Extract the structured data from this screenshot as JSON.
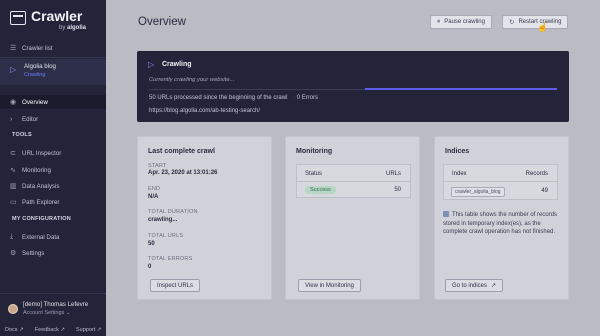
{
  "app": {
    "name": "Crawler",
    "by": "by",
    "brand": "algolia"
  },
  "sidebar": {
    "crawler_list": "Crawler list",
    "project": {
      "name": "Algolia blog",
      "status": "Crawling"
    },
    "items_top": [
      {
        "label": "Overview",
        "icon": "eye-icon"
      },
      {
        "label": "Editor",
        "icon": "code-icon"
      }
    ],
    "tools_heading": "TOOLS",
    "tools": [
      {
        "label": "URL Inspector"
      },
      {
        "label": "Monitoring"
      },
      {
        "label": "Data Analysis"
      },
      {
        "label": "Path Explorer"
      }
    ],
    "config_heading": "MY CONFIGURATION",
    "config": [
      {
        "label": "External Data"
      },
      {
        "label": "Settings"
      }
    ],
    "user": {
      "name": "[demo] Thomas Lefevre",
      "settings": "Account Settings"
    },
    "footer": {
      "docs": "Docs",
      "feedback": "Feedback",
      "support": "Support"
    }
  },
  "main": {
    "title": "Overview",
    "pause_button": "Pause crawling",
    "restart_button": "Restart crawling",
    "crawl": {
      "title": "Crawling",
      "status": "Currently crawling your website...",
      "urls_count": "50",
      "urls_text": "URLs processed since the beginning of the crawl",
      "errors_count": "0",
      "errors_text": "Errors",
      "url": "https://blog.algolia.com/ab-testing-search/",
      "progress": 0.47
    },
    "last_crawl": {
      "title": "Last complete crawl",
      "start_label": "START",
      "start_value": "Apr. 23, 2020 at 13:01:26",
      "end_label": "END",
      "end_value": "N/A",
      "duration_label": "TOTAL DURATION",
      "duration_value": "crawling...",
      "urls_label": "TOTAL URLS",
      "urls_value": "50",
      "errors_label": "TOTAL ERRORS",
      "errors_value": "0",
      "button": "Inspect URLs"
    },
    "monitoring": {
      "title": "Monitoring",
      "col_status": "Status",
      "col_urls": "URLs",
      "row_status": "Success",
      "row_urls": "50",
      "button": "View in Monitoring"
    },
    "indices": {
      "title": "Indices",
      "col_index": "Index",
      "col_records": "Records",
      "row_index": "crawler_algolia_blog",
      "row_records": "49",
      "note": "This table shows the number of records stored in temporary index(es), as the complete crawl operation has not finished.",
      "button": "Go to indices"
    }
  },
  "colors": {
    "sidebar_bg": "#23243a",
    "accent": "#5d5de8",
    "page_bg": "#babbc3"
  }
}
